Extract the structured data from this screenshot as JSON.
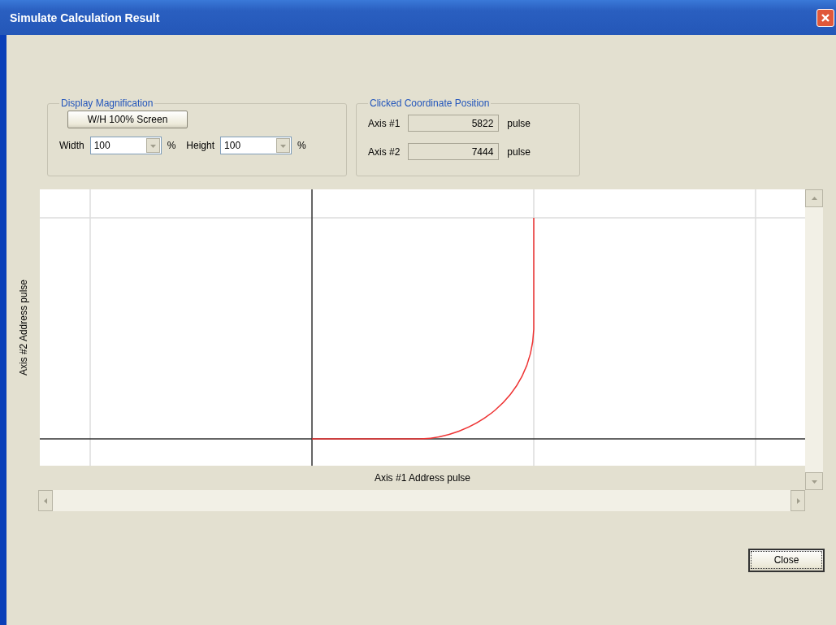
{
  "window": {
    "title": "Simulate Calculation Result"
  },
  "display_magnification": {
    "title": "Display Magnification",
    "screen_button": "W/H 100% Screen",
    "fields": [
      {
        "label": "Width",
        "value": "100",
        "unit": "%"
      },
      {
        "label": "Height",
        "value": "100",
        "unit": "%"
      }
    ]
  },
  "clicked_position": {
    "title": "Clicked Coordinate Position",
    "axes": [
      {
        "label": "Axis #1",
        "value": "5822",
        "unit": "pulse"
      },
      {
        "label": "Axis #2",
        "value": "7444",
        "unit": "pulse"
      }
    ]
  },
  "plot": {
    "xlabel": "Axis #1 Address pulse",
    "ylabel": "Axis #2 Address pulse"
  },
  "buttons": [
    {
      "label": "Close",
      "focused": true
    }
  ]
}
